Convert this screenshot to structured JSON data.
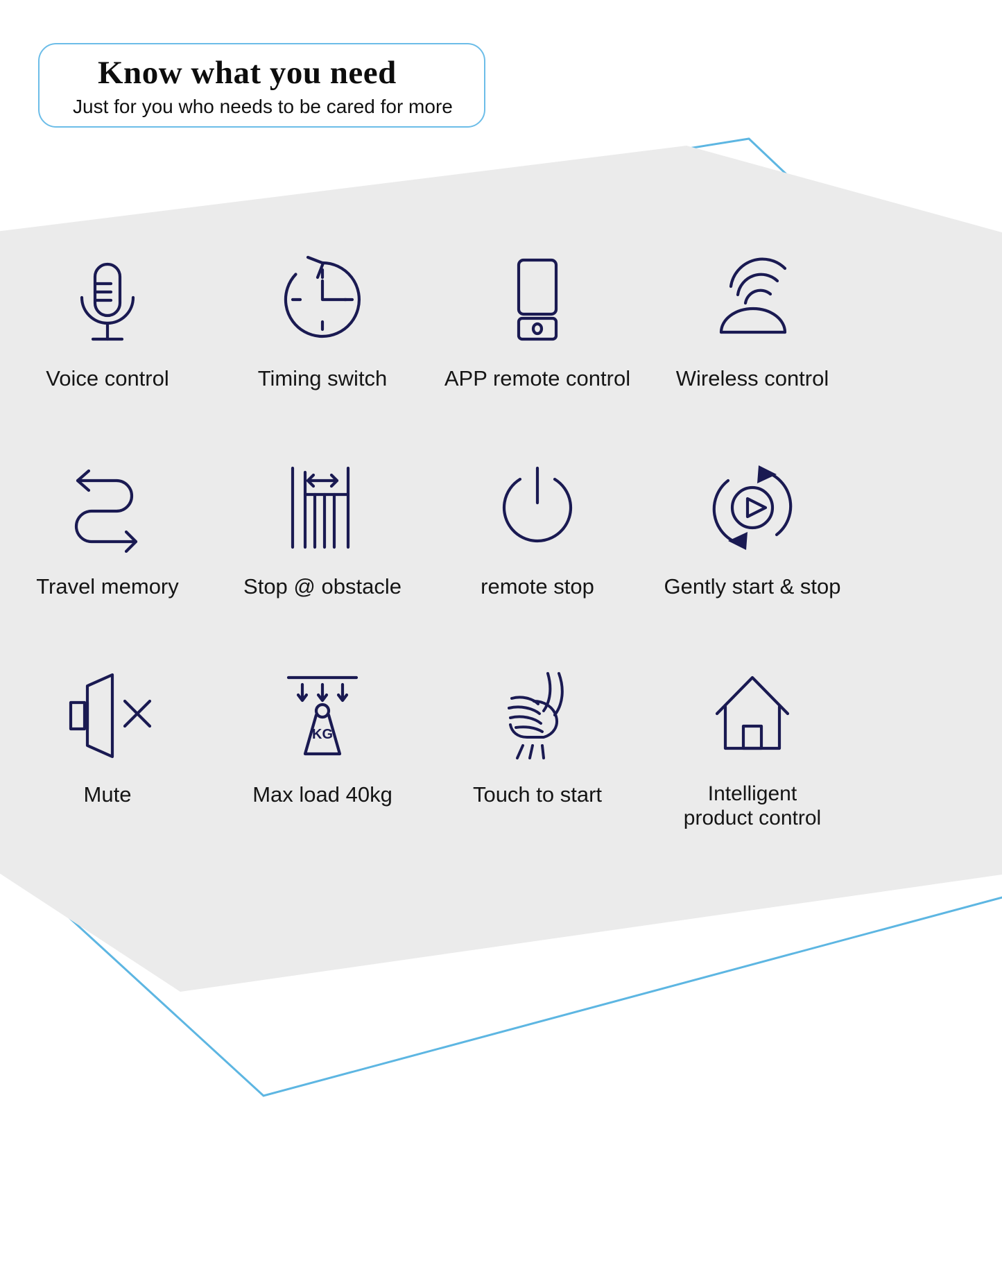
{
  "header": {
    "title": "Know what you need",
    "subtitle": "Just for you who needs to be cared for more"
  },
  "colors": {
    "icon_stroke": "#1a1a52",
    "outline_blue": "#6cbde8",
    "panel_gray": "#eaeaea",
    "background": "#ffffff",
    "text": "#151515"
  },
  "features": [
    {
      "icon": "microphone-icon",
      "label": "Voice control"
    },
    {
      "icon": "clock-timer-icon",
      "label": "Timing switch"
    },
    {
      "icon": "smartphone-app-icon",
      "label": "APP remote control"
    },
    {
      "icon": "wireless-signal-icon",
      "label": "Wireless control"
    },
    {
      "icon": "route-memory-icon",
      "label": "Travel memory"
    },
    {
      "icon": "obstacle-stop-icon",
      "label": "Stop @ obstacle"
    },
    {
      "icon": "power-button-icon",
      "label": "remote stop"
    },
    {
      "icon": "soft-start-stop-icon",
      "label": "Gently start & stop"
    },
    {
      "icon": "mute-speaker-icon",
      "label": "Mute"
    },
    {
      "icon": "max-load-weight-icon",
      "label": "Max load 40kg"
    },
    {
      "icon": "touch-hand-icon",
      "label": "Touch to start"
    },
    {
      "icon": "smart-home-icon",
      "label": "Intelligent\nproduct control"
    }
  ]
}
